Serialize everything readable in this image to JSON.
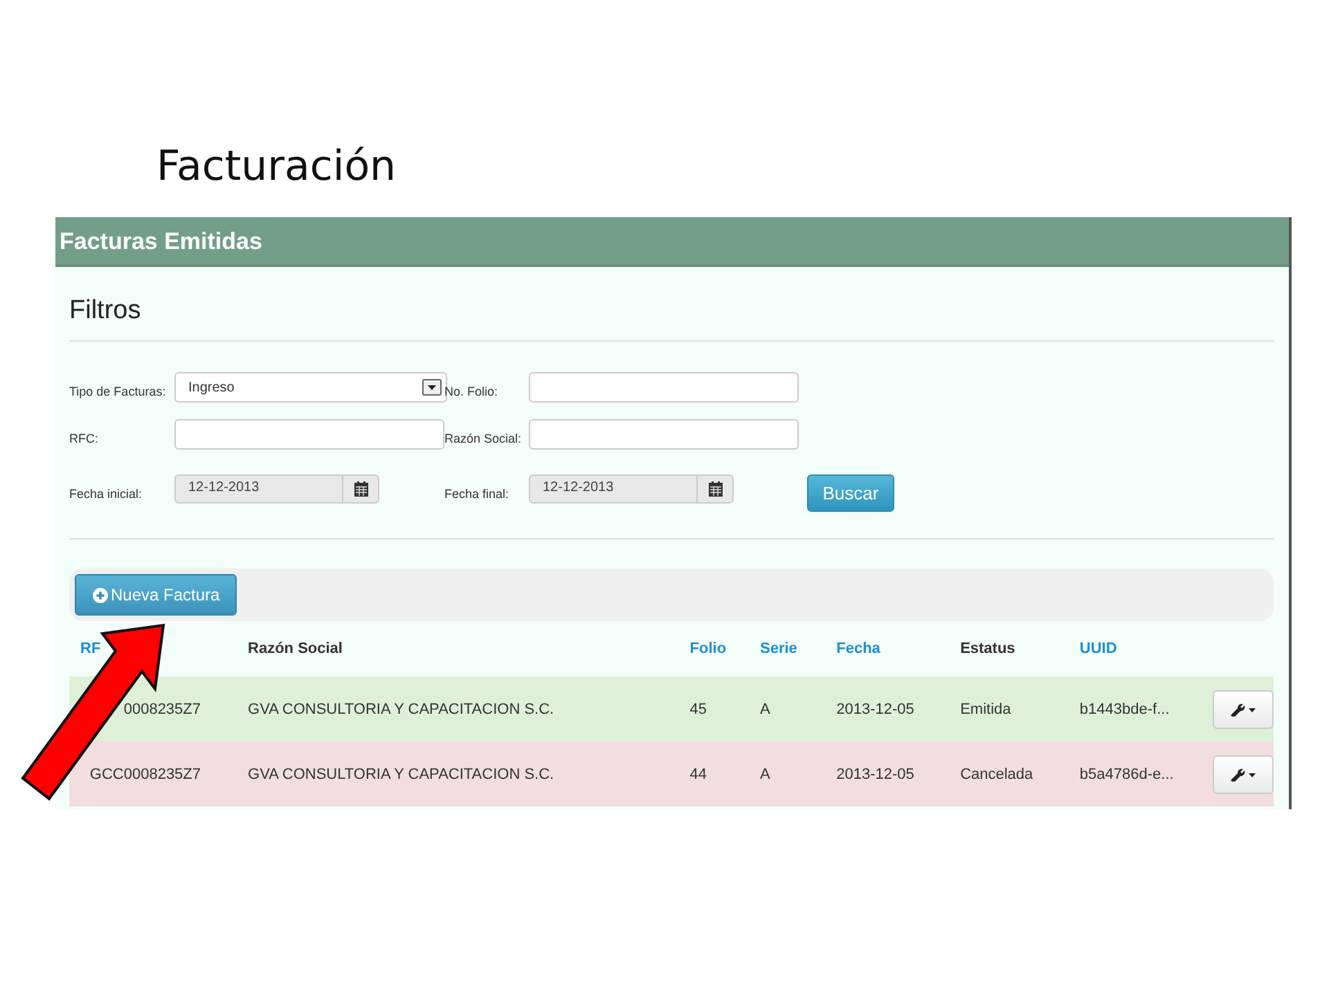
{
  "slide_title": "Facturación",
  "panel": {
    "title": "Facturas Emitidas",
    "filters": {
      "heading": "Filtros",
      "fields": [
        {
          "kind": "select",
          "label": "Tipo de Facturas:",
          "value": "Ingreso"
        },
        {
          "kind": "text",
          "label": "No. Folio:"
        },
        {
          "kind": "text",
          "label": "RFC:"
        },
        {
          "kind": "text",
          "label": "Razón Social:"
        },
        {
          "kind": "date",
          "label": "Fecha inicial:",
          "value": "12-12-2013"
        },
        {
          "kind": "date",
          "label": "Fecha final:",
          "value": "12-12-2013"
        }
      ],
      "search_button": "Buscar"
    },
    "new_button": "Nueva Factura",
    "table": {
      "columns": [
        {
          "label": "RF",
          "sortable": true
        },
        {
          "label": "Razón Social",
          "sortable": false
        },
        {
          "label": "Folio",
          "sortable": true
        },
        {
          "label": "Serie",
          "sortable": true
        },
        {
          "label": "Fecha",
          "sortable": true
        },
        {
          "label": "Estatus",
          "sortable": false
        },
        {
          "label": "UUID",
          "sortable": true
        }
      ],
      "rows": [
        {
          "color": "#dff0d8",
          "cells": [
            "0008235Z7",
            "GVA CONSULTORIA Y CAPACITACION S.C.",
            "45",
            "A",
            "2013-12-05",
            "Emitida",
            "b1443bde-f..."
          ]
        },
        {
          "color": "#f2dede",
          "cells": [
            "GCC0008235Z7",
            "GVA CONSULTORIA Y CAPACITACION S.C.",
            "44",
            "A",
            "2013-12-05",
            "Cancelada",
            "b5a4786d-e..."
          ]
        }
      ]
    }
  }
}
